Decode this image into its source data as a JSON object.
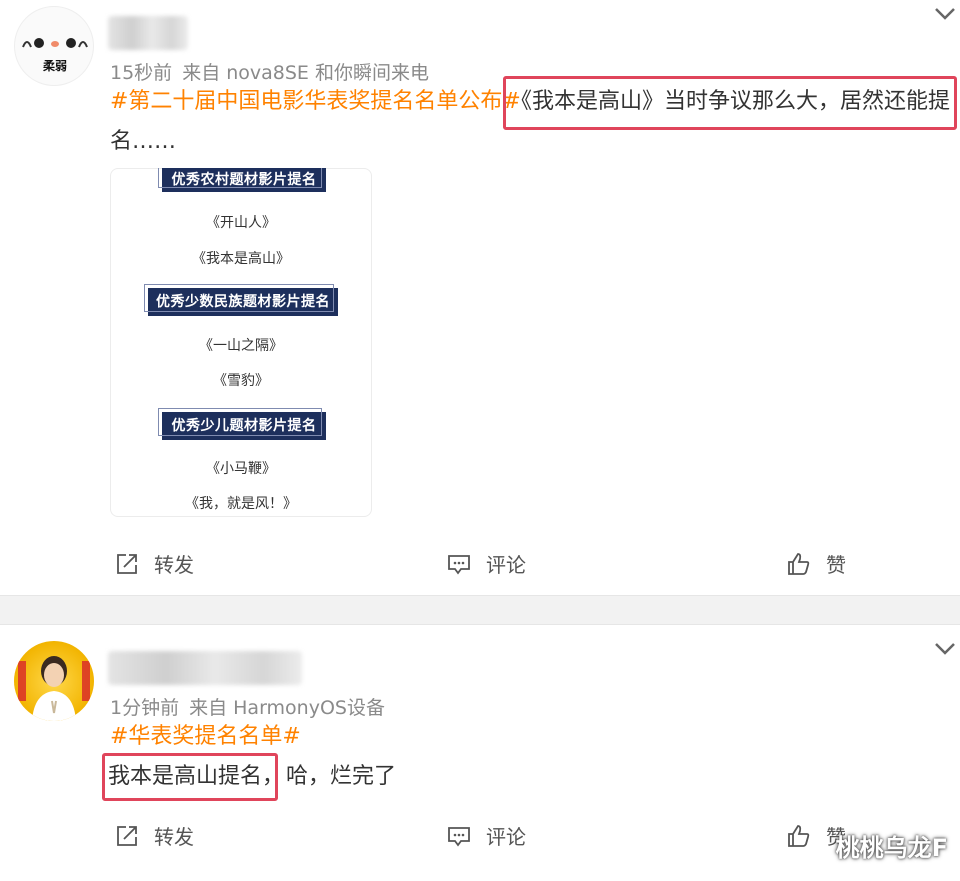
{
  "post1": {
    "avatar_text": "柔弱",
    "time": "15秒前",
    "source": "来自 nova8SE 和你瞬间来电",
    "topic": "#第二十届中国电影华表奖提名名单公布#",
    "highlight_text": "《我本是高山》当时争议那么大，居然还能提",
    "text_line2": "名……",
    "image": {
      "categories": [
        {
          "title": "优秀农村题材影片提名",
          "films": [
            "《开山人》",
            "《我本是高山》"
          ]
        },
        {
          "title": "优秀少数民族题材影片提名",
          "films": [
            "《一山之隔》",
            "《雪豹》"
          ]
        },
        {
          "title": "优秀少儿题材影片提名",
          "films": [
            "《小马鞭》",
            "《我，就是风！》"
          ]
        }
      ]
    },
    "actions": {
      "repost": "转发",
      "comment": "评论",
      "like": "赞"
    }
  },
  "post2": {
    "time": "1分钟前",
    "source": "来自 HarmonyOS设备",
    "topic": "#华表奖提名名单#",
    "highlight_text": "我本是高山提名，",
    "text_rest": "哈，烂完了",
    "actions": {
      "repost": "转发",
      "comment": "评论",
      "like": "赞"
    }
  },
  "watermark": "桃桃乌龙F",
  "colors": {
    "topic": "#ff8200",
    "highlight_border": "#e0455b",
    "banner": "#1d2f5c"
  }
}
